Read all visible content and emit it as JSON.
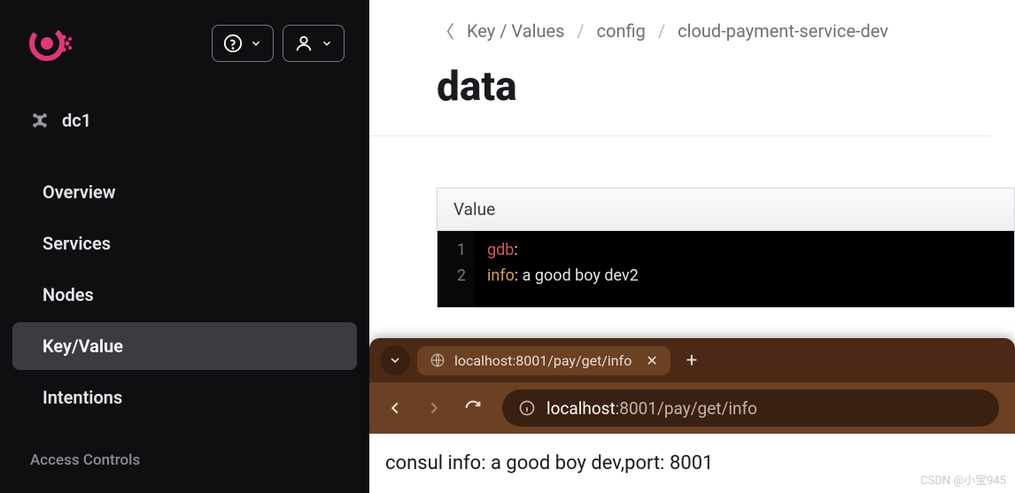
{
  "sidebar": {
    "datacenter": "dc1",
    "nav": [
      "Overview",
      "Services",
      "Nodes",
      "Key/Value",
      "Intentions"
    ],
    "active_index": 3,
    "section": "Access Controls"
  },
  "breadcrumbs": {
    "items": [
      "Key / Values",
      "config",
      "cloud-payment-service-dev"
    ]
  },
  "page": {
    "title": "data",
    "value_label": "Value"
  },
  "code": {
    "lines": [
      {
        "n": "1",
        "k": "gdb",
        "c": ":"
      },
      {
        "n": "2",
        "indent": "  ",
        "k": "info",
        "c": ": a good boy dev2"
      }
    ]
  },
  "browser": {
    "tab_title": "localhost:8001/pay/get/info",
    "url_host": "localhost",
    "url_port": ":8001",
    "url_path": "/pay/get/info",
    "page_text": "consul info: a good boy dev,port: 8001"
  },
  "watermark": "CSDN @小宝945"
}
